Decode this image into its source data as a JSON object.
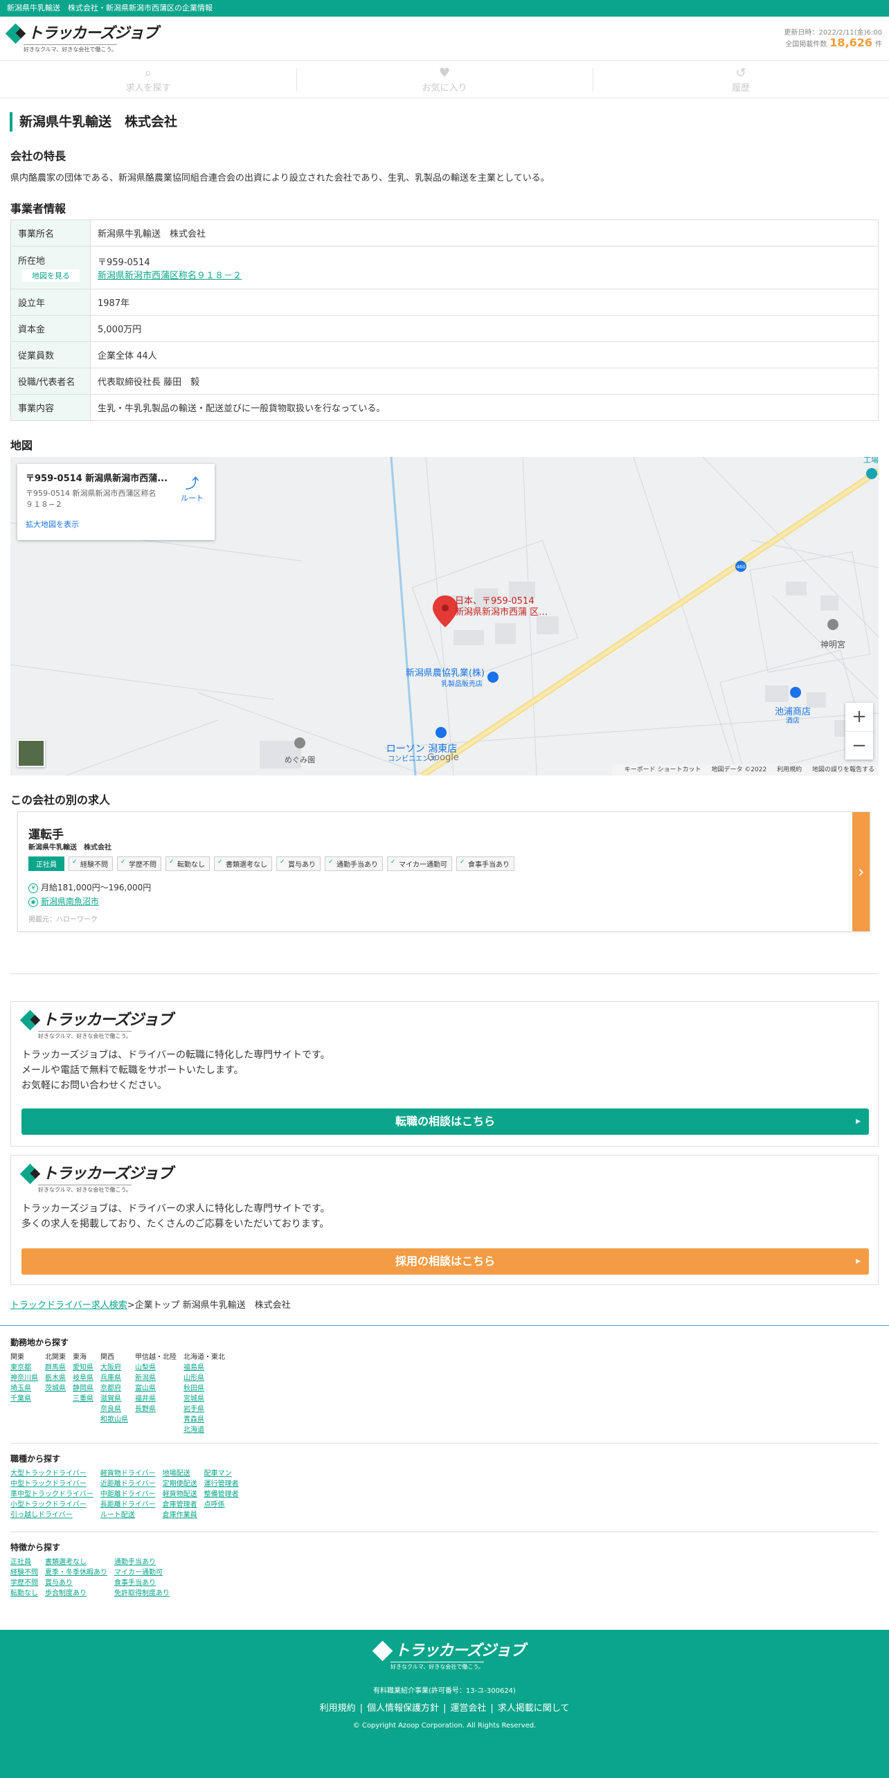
{
  "topbar": {
    "text": "新潟県牛乳輸送　株式会社・新潟県新潟市西蒲区の企業情報"
  },
  "header": {
    "logo_text": "トラッカーズジョブ",
    "logo_tagline": "好きなクルマ、好きな会社で働こう。",
    "updated": "更新日時：2022/2/11(金)6:00",
    "count_label": "全国掲載件数",
    "count": "18,626",
    "count_unit": "件"
  },
  "nav": [
    {
      "icon": "search-icon",
      "label": "求人を探す"
    },
    {
      "icon": "heart-icon",
      "label": "お気に入り"
    },
    {
      "icon": "history-icon",
      "label": "履歴"
    }
  ],
  "company": {
    "name": "新潟県牛乳輸送　株式会社",
    "features_heading": "会社の特長",
    "features_text": "県内酪農家の団体である、新潟県酪農業協同組合連合会の出資により設立された会社であり、生乳、乳製品の輸送を主業としている。",
    "info_heading": "事業者情報",
    "info": {
      "office_label": "事業所名",
      "office": "新潟県牛乳輸送　株式会社",
      "address_label": "所在地",
      "map_button": "地図を見る",
      "zip": "〒959-0514",
      "address": "新潟県新潟市西蒲区称名９１８－２",
      "founded_label": "設立年",
      "founded": "1987年",
      "capital_label": "資本金",
      "capital": "5,000万円",
      "employees_label": "従業員数",
      "employees": "企業全体 44人",
      "rep_label": "役職/代表者名",
      "rep": "代表取締役社長 藤田　毅",
      "business_label": "事業内容",
      "business": "生乳・牛乳乳製品の輸送・配送並びに一般貨物取扱いを行なっている。"
    }
  },
  "map": {
    "heading": "地図",
    "card_title": "〒959-0514 新潟県新潟市西蒲...",
    "card_address": "〒959-0514 新潟県新潟市西蒲区称名 ９１８−２",
    "card_link": "拡大地図を表示",
    "route_label": "ルート",
    "pin_label_1": "日本、〒959-0514",
    "pin_label_2": "新潟県新潟市西蒲 区…",
    "poi_1": "新潟県農協乳業(株)",
    "poi_1_sub": "乳製品販売店",
    "poi_2": "ローソン 潟東店",
    "poi_2_sub": "コンビニエンス",
    "poi_3": "めぐみ園",
    "poi_4": "神明宮",
    "poi_5": "池浦商店",
    "poi_5_sub": "酒店",
    "poi_6": "工場",
    "road_no": "460",
    "google": "Google",
    "zoom_in": "+",
    "zoom_out": "−",
    "foot_1": "キーボード ショートカット",
    "foot_2": "地図データ ©2022",
    "foot_3": "利用規約",
    "foot_4": "地図の誤りを報告する"
  },
  "other_jobs": {
    "heading": "この会社の別の求人",
    "job": {
      "title": "運転手",
      "company": "新潟県牛乳輸送　株式会社",
      "tags": [
        "正社員",
        "経験不問",
        "学歴不問",
        "転勤なし",
        "書類選考なし",
        "賞与あり",
        "通勤手当あり",
        "マイカー通勤可",
        "食事手当あり"
      ],
      "salary": "月給181,000円〜196,000円",
      "salary_icon": "¥",
      "location": "新潟県南魚沼市",
      "location_icon": "◉",
      "source": "掲載元：ハローワーク",
      "arrow": "›"
    }
  },
  "promo1": {
    "text": [
      "トラッカーズジョブは、ドライバーの転職に特化した専門サイトです。",
      "メールや電話で無料で転職をサポートいたします。",
      "お気軽にお問い合わせください。"
    ],
    "button": "転職の相談はこちら",
    "color": "#0aa58b"
  },
  "promo2": {
    "text": [
      "トラッカーズジョブは、ドライバーの求人に特化した専門サイトです。",
      "多くの求人を掲載しており、たくさんのご応募をいただいております。"
    ],
    "button": "採用の相談はこちら",
    "color": "#f39c45"
  },
  "breadcrumb": {
    "link": "トラックドライバー求人検索",
    "rest": ">企業トップ 新潟県牛乳輸送　株式会社"
  },
  "footer_search": {
    "area_heading": "勤務地から探す",
    "areas": [
      {
        "name": "関東",
        "prefs": [
          "東京都",
          "神奈川県",
          "埼玉県",
          "千葉県"
        ]
      },
      {
        "name": "北関東",
        "prefs": [
          "群馬県",
          "栃木県",
          "茨城県"
        ]
      },
      {
        "name": "東海",
        "prefs": [
          "愛知県",
          "岐阜県",
          "静岡県",
          "三重県"
        ]
      },
      {
        "name": "関西",
        "prefs": [
          "大阪府",
          "兵庫県",
          "京都府",
          "滋賀県",
          "奈良県",
          "和歌山県"
        ]
      },
      {
        "name": "甲信越・北陸",
        "prefs": [
          "山梨県",
          "新潟県",
          "富山県",
          "福井県",
          "長野県"
        ]
      },
      {
        "name": "北海道・東北",
        "prefs": [
          "福島県",
          "山形県",
          "秋田県",
          "宮城県",
          "岩手県",
          "青森県",
          "北海道"
        ]
      }
    ],
    "job_heading": "職種から探す",
    "jobs": [
      [
        "大型トラックドライバー",
        "中型トラックドライバー",
        "準中型トラックドライバー",
        "小型トラックドライバー",
        "引っ越しドライバー"
      ],
      [
        "軽貨物ドライバー",
        "近距離ドライバー",
        "中距離ドライバー",
        "長距離ドライバー",
        "ルート配送"
      ],
      [
        "地場配送",
        "定期便配送",
        "軽貨物配送",
        "倉庫管理者",
        "倉庫作業員"
      ],
      [
        "配車マン",
        "運行管理者",
        "整備管理者",
        "点呼係"
      ]
    ],
    "feature_heading": "特徴から探す",
    "features": [
      [
        "正社員",
        "経験不問",
        "学歴不問",
        "転勤なし"
      ],
      [
        "書類選考なし",
        "夏季・冬季休暇あり",
        "賞与あり",
        "歩合制度あり"
      ],
      [
        "通勤手当あり",
        "マイカー通勤可",
        "食事手当あり",
        "免許取得制度あり"
      ]
    ]
  },
  "footer": {
    "license": "有料職業紹介事業(許可番号：13-ユ-300624)",
    "links": [
      "利用規約",
      "個人情報保護方針",
      "運営会社",
      "求人掲載に関して"
    ],
    "copyright": "© Copyright Azoop Corporation. All Rights Reserved."
  }
}
